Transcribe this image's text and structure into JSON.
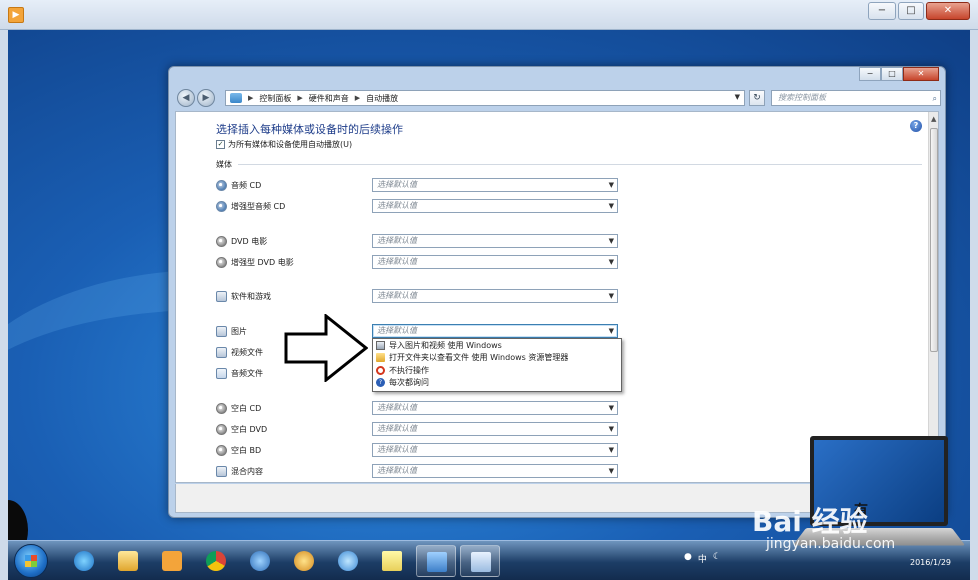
{
  "outer_window": {
    "app_icon": "media-player-icon",
    "minimize": "−",
    "maximize": "□",
    "close": "✕"
  },
  "control_panel": {
    "window_controls": {
      "minimize": "−",
      "maximize": "□",
      "close": "✕"
    },
    "breadcrumbs": [
      "控制面板",
      "硬件和声音",
      "自动播放"
    ],
    "search_placeholder": "搜索控制面板",
    "page_title": "选择插入每种媒体或设备时的后续操作",
    "use_autoplay_label": "为所有媒体和设备使用自动播放(U)",
    "use_autoplay_checked": true,
    "media_section": "媒体",
    "select_placeholder": "选择默认值",
    "items": [
      {
        "label": "音频 CD",
        "icon": "audio-cd-icon"
      },
      {
        "label": "增强型音频 CD",
        "icon": "enhanced-audio-cd-icon"
      },
      {
        "label": "DVD 电影",
        "icon": "dvd-movie-icon"
      },
      {
        "label": "增强型 DVD 电影",
        "icon": "enhanced-dvd-icon"
      },
      {
        "label": "软件和游戏",
        "icon": "software-games-icon"
      },
      {
        "label": "图片",
        "icon": "pictures-icon"
      },
      {
        "label": "视频文件",
        "icon": "video-files-icon"
      },
      {
        "label": "音频文件",
        "icon": "audio-files-icon"
      },
      {
        "label": "空白 CD",
        "icon": "blank-cd-icon"
      },
      {
        "label": "空白 DVD",
        "icon": "blank-dvd-icon"
      },
      {
        "label": "空白 BD",
        "icon": "blank-bd-icon"
      },
      {
        "label": "混合内容",
        "icon": "mixed-content-icon"
      }
    ],
    "dropdown_options": [
      {
        "label": "导入图片和视频 使用 Windows",
        "icon": "import-icon"
      },
      {
        "label": "打开文件夹以查看文件 使用 Windows 资源管理器",
        "icon": "folder-icon"
      },
      {
        "label": "不执行操作",
        "icon": "no-action-icon"
      },
      {
        "label": "每次都询问",
        "icon": "ask-icon"
      }
    ]
  },
  "taskbar": {
    "tray_text": "中",
    "date": "2016/1/29"
  },
  "watermark": {
    "brand": "Bai 经验",
    "url": "jingyan.baidu.com",
    "laptop_text": "有"
  },
  "colors": {
    "title_blue": "#1e3d8a",
    "desktop_blue": "#1a5fb4",
    "window_frame": "#bcd1ea"
  }
}
